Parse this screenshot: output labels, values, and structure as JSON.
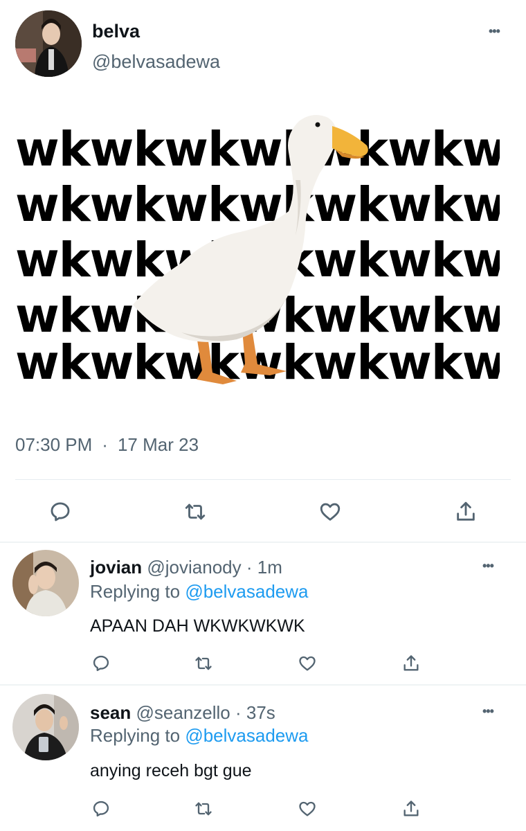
{
  "tweet": {
    "author_name": "belva",
    "author_handle": "@belvasadewa",
    "time": "07:30 PM",
    "separator": "·",
    "date": "17 Mar 23",
    "more_label": "•••",
    "media": {
      "lines": [
        "wkwkwkwkwkwkwk",
        "wkwkwkwkwkwkwk",
        "wkwkwkwkwkwkwk",
        "wkwkwkwkwkwkwk",
        "wkwkwkwkwkwkwk"
      ]
    }
  },
  "replies": [
    {
      "name": "jovian",
      "handle": "@jovianody",
      "separator": "·",
      "age": "1m",
      "replying_prefix": "Replying to",
      "replying_to": "@belvasadewa",
      "text": "APAAN DAH WKWKWKWK"
    },
    {
      "name": "sean",
      "handle": "@seanzello",
      "separator": "·",
      "age": "37s",
      "replying_prefix": "Replying to",
      "replying_to": "@belvasadewa",
      "text": "anying receh bgt gue"
    }
  ],
  "icons": {
    "reply": "reply-icon",
    "retweet": "retweet-icon",
    "like": "heart-icon",
    "share": "share-icon",
    "more": "more-icon"
  },
  "colors": {
    "primary_text": "#0f1419",
    "secondary_text": "#536471",
    "mention": "#1d9bf0",
    "divider": "#eff3f4"
  }
}
